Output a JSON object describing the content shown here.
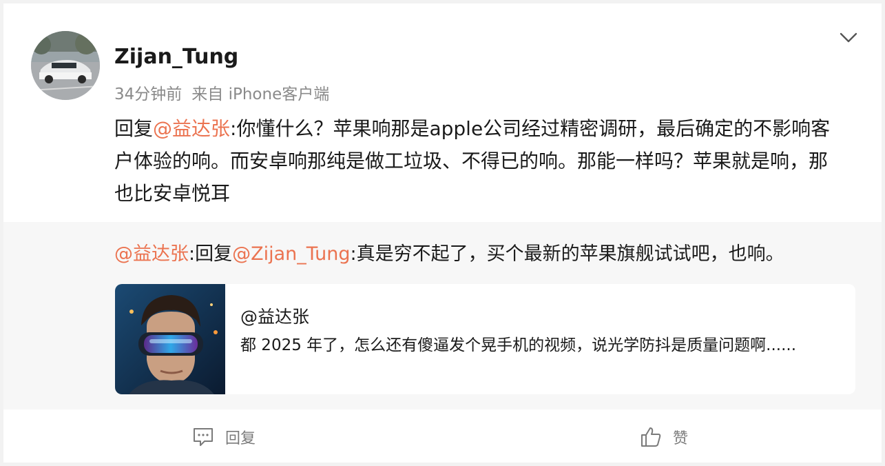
{
  "post": {
    "username": "Zijan_Tung",
    "time": "34分钟前",
    "source": "来自 iPhone客户端",
    "reply_prefix": "回复",
    "mention": "@益达张",
    "body": ":你懂什么？苹果响那是apple公司经过精密调研，最后确定的不影响客户体验的响。而安卓响那纯是做工垃圾、不得已的响。那能一样吗？苹果就是响，那也比安卓悦耳"
  },
  "quoted": {
    "mention_author": "@益达张",
    "sep": ":回复",
    "mention_target": "@Zijan_Tung",
    "body": ":真是穷不起了，买个最新的苹果旗舰试试吧，也响。"
  },
  "link_card": {
    "author": "@益达张",
    "body": "都 2025 年了，怎么还有傻逼发个晃手机的视频，说光学防抖是质量问题啊......"
  },
  "actions": {
    "reply_label": "回复",
    "like_label": "赞"
  },
  "icons": {
    "menu": "chevron-down-icon",
    "reply": "comment-icon",
    "like": "thumbs-up-icon"
  },
  "colors": {
    "mention": "#eb7350",
    "meta": "#8a8a8a",
    "quote_background": "#f7f7f7"
  }
}
